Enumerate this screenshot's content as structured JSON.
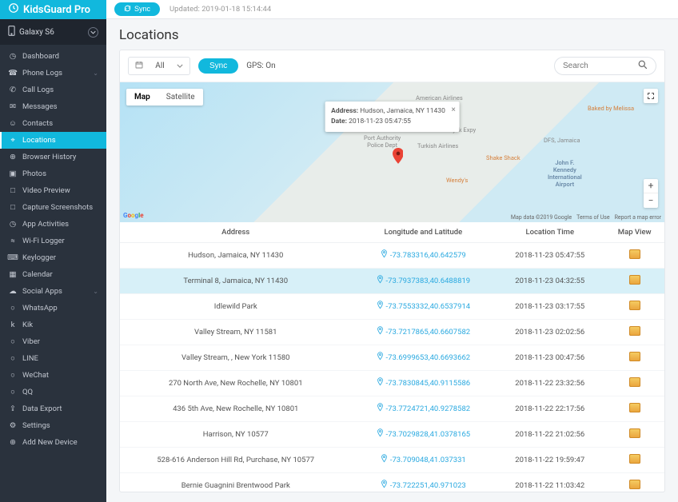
{
  "brand": "KidsGuard Pro",
  "device": {
    "name": "Galaxy S6"
  },
  "sidebar": {
    "items": [
      {
        "key": "dashboard",
        "label": "Dashboard",
        "icon": "gauge-icon"
      },
      {
        "key": "phone-logs",
        "label": "Phone Logs",
        "icon": "phone-icon",
        "expandable": true
      },
      {
        "key": "call-logs",
        "label": "Call Logs",
        "icon": "handset-icon"
      },
      {
        "key": "messages",
        "label": "Messages",
        "icon": "message-icon"
      },
      {
        "key": "contacts",
        "label": "Contacts",
        "icon": "user-icon"
      },
      {
        "key": "locations",
        "label": "Locations",
        "icon": "pin-icon",
        "active": true
      },
      {
        "key": "browser-history",
        "label": "Browser History",
        "icon": "globe-icon"
      },
      {
        "key": "photos",
        "label": "Photos",
        "icon": "image-icon"
      },
      {
        "key": "video-preview",
        "label": "Video Preview",
        "icon": "video-icon"
      },
      {
        "key": "capture-screenshots",
        "label": "Capture Screenshots",
        "icon": "camera-icon"
      },
      {
        "key": "app-activities",
        "label": "App Activities",
        "icon": "clock-icon"
      },
      {
        "key": "wifi-logger",
        "label": "Wi-Fi Logger",
        "icon": "wifi-icon"
      },
      {
        "key": "keylogger",
        "label": "Keylogger",
        "icon": "keyboard-icon"
      },
      {
        "key": "calendar",
        "label": "Calendar",
        "icon": "calendar-icon"
      },
      {
        "key": "social-apps",
        "label": "Social Apps",
        "icon": "chat-icon",
        "expandable": true
      },
      {
        "key": "whatsapp",
        "label": "WhatsApp",
        "icon": "whatsapp-icon"
      },
      {
        "key": "kik",
        "label": "Kik",
        "icon": "kik-icon"
      },
      {
        "key": "viber",
        "label": "Viber",
        "icon": "viber-icon"
      },
      {
        "key": "line",
        "label": "LINE",
        "icon": "line-icon"
      },
      {
        "key": "wechat",
        "label": "WeChat",
        "icon": "wechat-icon"
      },
      {
        "key": "qq",
        "label": "QQ",
        "icon": "qq-icon"
      },
      {
        "key": "data-export",
        "label": "Data Export",
        "icon": "export-icon"
      },
      {
        "key": "settings",
        "label": "Settings",
        "icon": "gear-icon"
      },
      {
        "key": "add-new-device",
        "label": "Add New Device",
        "icon": "plus-icon"
      }
    ]
  },
  "topbar": {
    "sync": "Sync",
    "updated": "Updated: 2019-01-18 15:14:44"
  },
  "page": {
    "title": "Locations"
  },
  "controls": {
    "filter_label": "All",
    "sync": "Sync",
    "gps_label": "GPS: On",
    "search_placeholder": "Search"
  },
  "map": {
    "tab_map": "Map",
    "tab_satellite": "Satellite",
    "info_address_label": "Address:",
    "info_address_value": "Hudson, Jamaica, NY 11430",
    "info_date_label": "Date:",
    "info_date_value": "2018-11-23 05:47:55",
    "credits": [
      "Map data ©2019 Google",
      "Terms of Use",
      "Report a map error"
    ],
    "labels": {
      "american": "American Airlines",
      "vanwyck": "Van Wyck Expy",
      "turkish": "Turkish Airlines",
      "portauth": "Port Authority\nPolice Dept",
      "shakeshack": "Shake Shack",
      "dfs": "DFS, Jamaica",
      "baked": "Baked by Melissa",
      "wendys": "Wendy's",
      "jfk": "John F.\nKennedy\nInternational\nAirport"
    }
  },
  "table": {
    "headers": {
      "address": "Address",
      "coords": "Longitude and Latitude",
      "time": "Location Time",
      "mapview": "Map View"
    },
    "rows": [
      {
        "address": "Hudson, Jamaica, NY 11430",
        "coords": "-73.783316,40.642579",
        "time": "2018-11-23 05:47:55"
      },
      {
        "address": "Terminal 8, Jamaica, NY 11430",
        "coords": "-73.7937383,40.6488819",
        "time": "2018-11-23 04:32:55",
        "highlight": true
      },
      {
        "address": "Idlewild Park",
        "coords": "-73.7553332,40.6537914",
        "time": "2018-11-23 03:17:55"
      },
      {
        "address": "Valley Stream, NY 11581",
        "coords": "-73.7217865,40.6607582",
        "time": "2018-11-23 02:02:56"
      },
      {
        "address": "Valley Stream, , New York 11580",
        "coords": "-73.6999653,40.6693662",
        "time": "2018-11-23 00:47:56"
      },
      {
        "address": "270 North Ave, New Rochelle, NY 10801",
        "coords": "-73.7830845,40.9115586",
        "time": "2018-11-22 23:32:56"
      },
      {
        "address": "436 5th Ave, New Rochelle, NY 10801",
        "coords": "-73.7724721,40.9278582",
        "time": "2018-11-22 22:17:56"
      },
      {
        "address": "Harrison, NY 10577",
        "coords": "-73.7029828,41.0378165",
        "time": "2018-11-22 21:02:56"
      },
      {
        "address": "528-616 Anderson Hill Rd, Purchase, NY 10577",
        "coords": "-73.709048,41.037331",
        "time": "2018-11-22 19:59:47"
      },
      {
        "address": "Bernie Guagnini Brentwood Park",
        "coords": "-73.722251,40.971023",
        "time": "2018-11-22 11:03:42"
      }
    ]
  }
}
